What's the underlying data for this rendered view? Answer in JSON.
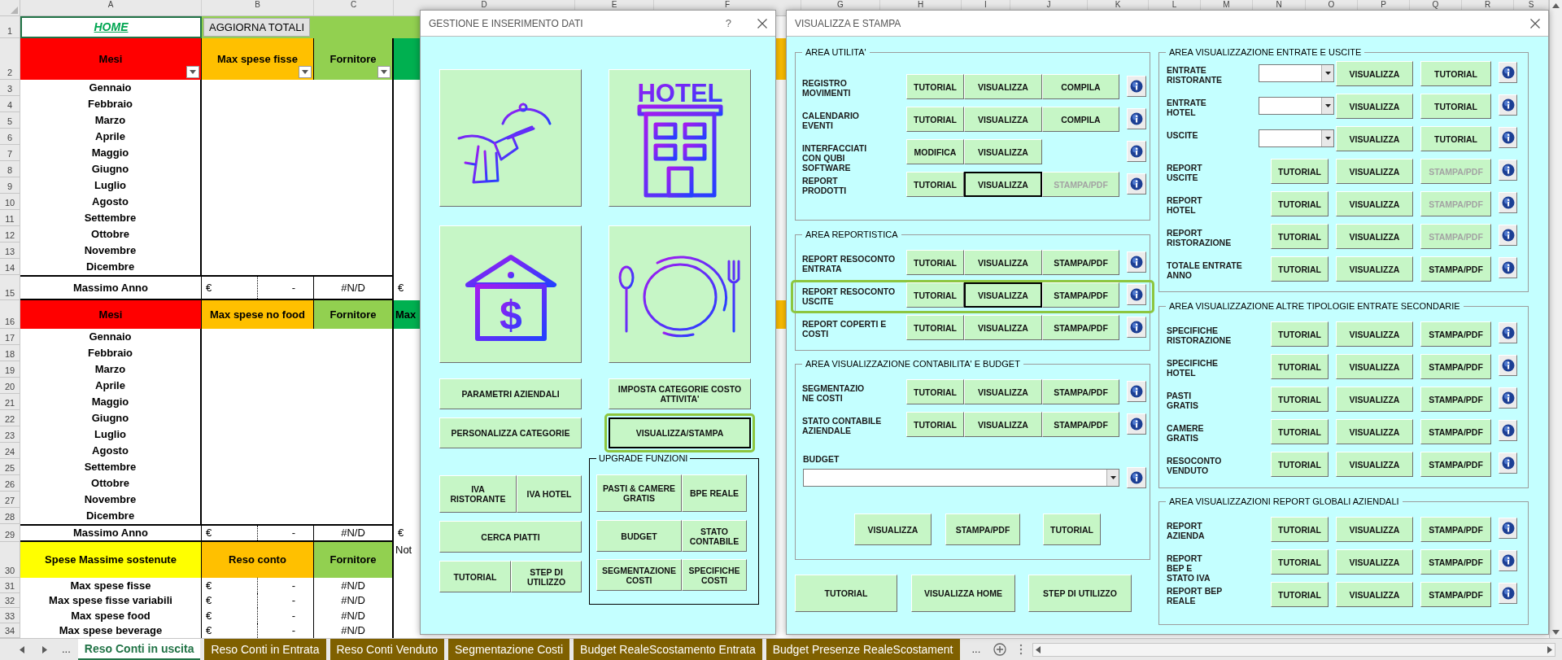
{
  "sheet": {
    "columns": [
      "A",
      "B",
      "C",
      "D",
      "E",
      "F",
      "G",
      "H",
      "I",
      "J",
      "K",
      "L",
      "M",
      "N",
      "O",
      "P",
      "Q",
      "R",
      "S"
    ],
    "rows": [
      {
        "number": "1",
        "kind": "top",
        "cells": [
          {
            "kind": "link",
            "text": "HOME"
          },
          {
            "kind": "button",
            "text": "AGGIORNA TOTALI",
            "color": "#92d050"
          },
          {
            "kind": "fill",
            "color": "#92d050"
          },
          {
            "kind": "fill",
            "color": "#92d050"
          }
        ]
      },
      {
        "number": "2",
        "kind": "header",
        "filters": true,
        "cells": [
          {
            "kind": "header",
            "text": "Mesi",
            "color": "#ff0000"
          },
          {
            "kind": "header",
            "text": "Max spese fisse",
            "color": "#ffc000"
          },
          {
            "kind": "header",
            "text": "Fornitore",
            "color": "#92d050"
          },
          {
            "kind": "fill",
            "color": "#00b050"
          },
          {
            "kind": "blank"
          },
          {
            "kind": "fill",
            "color": "#ffc000"
          }
        ]
      },
      {
        "number": "3",
        "kind": "month",
        "cells": [
          {
            "kind": "label",
            "text": "Gennaio"
          }
        ]
      },
      {
        "number": "4",
        "kind": "month",
        "cells": [
          {
            "kind": "label",
            "text": "Febbraio"
          }
        ]
      },
      {
        "number": "5",
        "kind": "month",
        "cells": [
          {
            "kind": "label",
            "text": "Marzo"
          }
        ]
      },
      {
        "number": "6",
        "kind": "month",
        "cells": [
          {
            "kind": "label",
            "text": "Aprile"
          }
        ]
      },
      {
        "number": "7",
        "kind": "month",
        "cells": [
          {
            "kind": "label",
            "text": "Maggio"
          }
        ]
      },
      {
        "number": "8",
        "kind": "month",
        "cells": [
          {
            "kind": "label",
            "text": "Giugno"
          }
        ]
      },
      {
        "number": "9",
        "kind": "month",
        "cells": [
          {
            "kind": "label",
            "text": "Luglio"
          }
        ]
      },
      {
        "number": "10",
        "kind": "month",
        "cells": [
          {
            "kind": "label",
            "text": "Agosto"
          }
        ]
      },
      {
        "number": "11",
        "kind": "month",
        "cells": [
          {
            "kind": "label",
            "text": "Settembre"
          }
        ]
      },
      {
        "number": "12",
        "kind": "month",
        "cells": [
          {
            "kind": "label",
            "text": "Ottobre"
          }
        ]
      },
      {
        "number": "13",
        "kind": "month",
        "cells": [
          {
            "kind": "label",
            "text": "Novembre"
          }
        ]
      },
      {
        "number": "14",
        "kind": "month",
        "cells": [
          {
            "kind": "label",
            "text": "Dicembre"
          }
        ]
      },
      {
        "number": "15",
        "kind": "total",
        "cells": [
          {
            "kind": "label",
            "text": "Massimo Anno"
          },
          {
            "kind": "currency",
            "symbol": "€",
            "value": "-"
          },
          {
            "kind": "value",
            "text": "#N/D"
          },
          {
            "kind": "currency",
            "symbol": "€"
          }
        ]
      },
      {
        "number": "16",
        "kind": "header",
        "filters": false,
        "cells": [
          {
            "kind": "header",
            "text": "Mesi",
            "color": "#ff0000"
          },
          {
            "kind": "header",
            "text": "Max spese no food",
            "color": "#ffc000"
          },
          {
            "kind": "header",
            "text": "Fornitore",
            "color": "#92d050"
          },
          {
            "kind": "partial",
            "text": "Max",
            "color": "#00b050"
          },
          {
            "kind": "blank"
          },
          {
            "kind": "fill",
            "color": "#ffc000"
          }
        ]
      },
      {
        "number": "17",
        "kind": "month",
        "cells": [
          {
            "kind": "label",
            "text": "Gennaio"
          }
        ]
      },
      {
        "number": "18",
        "kind": "month",
        "cells": [
          {
            "kind": "label",
            "text": "Febbraio"
          }
        ]
      },
      {
        "number": "19",
        "kind": "month",
        "cells": [
          {
            "kind": "label",
            "text": "Marzo"
          }
        ]
      },
      {
        "number": "20",
        "kind": "month",
        "cells": [
          {
            "kind": "label",
            "text": "Aprile"
          }
        ]
      },
      {
        "number": "21",
        "kind": "month",
        "cells": [
          {
            "kind": "label",
            "text": "Maggio"
          }
        ]
      },
      {
        "number": "22",
        "kind": "month",
        "cells": [
          {
            "kind": "label",
            "text": "Giugno"
          }
        ]
      },
      {
        "number": "23",
        "kind": "month",
        "cells": [
          {
            "kind": "label",
            "text": "Luglio"
          }
        ]
      },
      {
        "number": "24",
        "kind": "month",
        "cells": [
          {
            "kind": "label",
            "text": "Agosto"
          }
        ]
      },
      {
        "number": "25",
        "kind": "month",
        "cells": [
          {
            "kind": "label",
            "text": "Settembre"
          }
        ]
      },
      {
        "number": "26",
        "kind": "month",
        "cells": [
          {
            "kind": "label",
            "text": "Ottobre"
          }
        ]
      },
      {
        "number": "27",
        "kind": "month",
        "cells": [
          {
            "kind": "label",
            "text": "Novembre"
          }
        ]
      },
      {
        "number": "28",
        "kind": "month",
        "cells": [
          {
            "kind": "label",
            "text": "Dicembre"
          }
        ]
      },
      {
        "number": "29",
        "kind": "total",
        "cells": [
          {
            "kind": "label",
            "text": "Massimo Anno"
          },
          {
            "kind": "currency",
            "symbol": "€",
            "value": "-"
          },
          {
            "kind": "value",
            "text": "#N/D"
          },
          {
            "kind": "currency",
            "symbol": "€"
          }
        ]
      },
      {
        "number": "30",
        "kind": "header",
        "filters": false,
        "cells": [
          {
            "kind": "header",
            "text": "Spese Massime sostenute",
            "color": "#ffff00"
          },
          {
            "kind": "header",
            "text": "Reso conto",
            "color": "#ffc000"
          },
          {
            "kind": "header",
            "text": "Fornitore",
            "color": "#92d050"
          },
          {
            "kind": "note",
            "text": "Not"
          }
        ]
      },
      {
        "number": "31",
        "kind": "detail",
        "cells": [
          {
            "kind": "label",
            "text": "Max spese fisse"
          },
          {
            "kind": "currency",
            "symbol": "€",
            "value": "-"
          },
          {
            "kind": "value",
            "text": "#N/D"
          }
        ]
      },
      {
        "number": "32",
        "kind": "detail",
        "cells": [
          {
            "kind": "label",
            "text": "Max spese fisse variabili"
          },
          {
            "kind": "currency",
            "symbol": "€",
            "value": "-"
          },
          {
            "kind": "value",
            "text": "#N/D"
          }
        ]
      },
      {
        "number": "33",
        "kind": "detail",
        "cells": [
          {
            "kind": "label",
            "text": "Max spese food"
          },
          {
            "kind": "currency",
            "symbol": "€",
            "value": "-"
          },
          {
            "kind": "value",
            "text": "#N/D"
          }
        ]
      },
      {
        "number": "34",
        "kind": "detail",
        "cells": [
          {
            "kind": "label",
            "text": "Max spese beverage"
          },
          {
            "kind": "currency",
            "symbol": "€",
            "value": "-"
          },
          {
            "kind": "value",
            "text": "#N/D"
          }
        ]
      }
    ]
  },
  "sheet_tabs": {
    "more_left": "...",
    "more_right": "...",
    "tabs": [
      {
        "label": "Reso Conti in uscita",
        "selected": true
      },
      {
        "label": "Reso Conti in Entrata",
        "selected": false
      },
      {
        "label": "Reso Conti Venduto",
        "selected": false
      },
      {
        "label": "Segmentazione Costi",
        "selected": false
      },
      {
        "label": "Budget RealeScostamento Entrata",
        "selected": false
      },
      {
        "label": "Budget Presenze RealeScostament",
        "selected": false
      }
    ]
  },
  "manage_dialog": {
    "title": "GESTIONE E INSERIMENTO DATI",
    "help": "?",
    "tiles": [
      {
        "kind": "waiter"
      },
      {
        "kind": "hotel",
        "sign": "HOTEL"
      },
      {
        "kind": "house",
        "symbol": "$"
      },
      {
        "kind": "plate"
      }
    ],
    "buttons": [
      {
        "label": "PARAMETRI AZIENDALI",
        "highlighted": false,
        "focused": false
      },
      {
        "label": "IMPOSTA CATEGORIE COSTO\nATTIVITA'",
        "highlighted": false,
        "focused": false
      },
      {
        "label": "PERSONALIZZA CATEGORIE",
        "highlighted": false,
        "focused": false
      },
      {
        "label": "VISUALIZZA/STAMPA",
        "highlighted": true,
        "focused": true
      }
    ],
    "small_buttons": [
      [
        "IVA\nRISTORANTE",
        "IVA HOTEL"
      ],
      [
        "CERCA PIATTI"
      ],
      [
        "TUTORIAL",
        "STEP DI\nUTILIZZO"
      ]
    ],
    "upgrade": {
      "title": "UPGRADE FUNZIONI",
      "buttons": [
        [
          "PASTI & CAMERE\nGRATIS",
          "BPE REALE"
        ],
        [
          "BUDGET",
          "STATO\nCONTABILE"
        ],
        [
          "SEGMENTAZIONE\nCOSTI",
          "SPECIFICHE\nCOSTI"
        ]
      ]
    }
  },
  "print_dialog": {
    "title": "VISUALIZZA E STAMPA",
    "left": [
      {
        "title": "AREA UTILITA'",
        "rows": [
          {
            "label": "REGISTRO\nMOVIMENTI",
            "highlighted": false,
            "controls": [
              {
                "kind": "button",
                "label": "TUTORIAL",
                "disabled": false,
                "focused": false
              },
              {
                "kind": "button",
                "label": "VISUALIZZA",
                "disabled": false,
                "focused": false
              },
              {
                "kind": "button",
                "label": "COMPILA",
                "disabled": false,
                "focused": false
              }
            ]
          },
          {
            "label": "CALENDARIO\nEVENTI",
            "highlighted": false,
            "controls": [
              {
                "kind": "button",
                "label": "TUTORIAL",
                "disabled": false,
                "focused": false
              },
              {
                "kind": "button",
                "label": "VISUALIZZA",
                "disabled": false,
                "focused": false
              },
              {
                "kind": "button",
                "label": "COMPILA",
                "disabled": false,
                "focused": false
              }
            ]
          },
          {
            "label": "INTERFACCIATI\nCON QUBI\nSOFTWARE",
            "highlighted": false,
            "controls": [
              {
                "kind": "button",
                "label": "MODIFICA",
                "disabled": false,
                "focused": false
              },
              {
                "kind": "button",
                "label": "VISUALIZZA",
                "disabled": false,
                "focused": false
              }
            ]
          },
          {
            "label": "REPORT\nPRODOTTI",
            "highlighted": false,
            "controls": [
              {
                "kind": "button",
                "label": "TUTORIAL",
                "disabled": false,
                "focused": false
              },
              {
                "kind": "button",
                "label": "VISUALIZZA",
                "disabled": false,
                "focused": true
              },
              {
                "kind": "button",
                "label": "STAMPA/PDF",
                "disabled": true,
                "focused": false
              }
            ]
          }
        ]
      },
      {
        "title": "AREA REPORTISTICA",
        "rows": [
          {
            "label": "REPORT RESOCONTO\nENTRATA",
            "highlighted": false,
            "controls": [
              {
                "kind": "button",
                "label": "TUTORIAL",
                "disabled": false,
                "focused": false
              },
              {
                "kind": "button",
                "label": "VISUALIZZA",
                "disabled": false,
                "focused": false
              },
              {
                "kind": "button",
                "label": "STAMPA/PDF",
                "disabled": false,
                "focused": false
              }
            ]
          },
          {
            "label": "REPORT RESOCONTO\nUSCITE",
            "highlighted": true,
            "controls": [
              {
                "kind": "button",
                "label": "TUTORIAL",
                "disabled": false,
                "focused": false
              },
              {
                "kind": "button",
                "label": "VISUALIZZA",
                "disabled": false,
                "focused": true
              },
              {
                "kind": "button",
                "label": "STAMPA/PDF",
                "disabled": false,
                "focused": false
              }
            ]
          },
          {
            "label": "REPORT COPERTI E\nCOSTI",
            "highlighted": false,
            "controls": [
              {
                "kind": "button",
                "label": "TUTORIAL",
                "disabled": false,
                "focused": false
              },
              {
                "kind": "button",
                "label": "VISUALIZZA",
                "disabled": false,
                "focused": false
              },
              {
                "kind": "button",
                "label": "STAMPA/PDF",
                "disabled": false,
                "focused": false
              }
            ]
          }
        ]
      },
      {
        "title": "AREA VISUALIZZAZIONE CONTABILITA' E BUDGET",
        "rows": [
          {
            "label": "SEGMENTAZIO\nNE COSTI",
            "highlighted": false,
            "controls": [
              {
                "kind": "button",
                "label": "TUTORIAL",
                "disabled": false,
                "focused": false
              },
              {
                "kind": "button",
                "label": "VISUALIZZA",
                "disabled": false,
                "focused": false
              },
              {
                "kind": "button",
                "label": "STAMPA/PDF",
                "disabled": false,
                "focused": false
              }
            ]
          },
          {
            "label": "STATO CONTABILE\nAZIENDALE",
            "highlighted": false,
            "controls": [
              {
                "kind": "button",
                "label": "TUTORIAL",
                "disabled": false,
                "focused": false
              },
              {
                "kind": "button",
                "label": "VISUALIZZA",
                "disabled": false,
                "focused": false
              },
              {
                "kind": "button",
                "label": "STAMPA/PDF",
                "disabled": false,
                "focused": false
              }
            ]
          }
        ],
        "budget": {
          "label": "BUDGET",
          "actions": [
            "VISUALIZZA",
            "STAMPA/PDF",
            "TUTORIAL"
          ]
        }
      }
    ],
    "footer": [
      "TUTORIAL",
      "VISUALIZZA HOME",
      "STEP DI UTILIZZO"
    ],
    "right": [
      {
        "title": "AREA VISUALIZZAZIONE ENTRATE E USCITE",
        "rows": [
          {
            "label": "ENTRATE\nRISTORANTE",
            "highlighted": false,
            "controls": [
              {
                "kind": "dropdown"
              },
              {
                "kind": "button",
                "label": "VISUALIZZA",
                "disabled": false,
                "focused": false
              },
              {
                "kind": "button",
                "label": "TUTORIAL",
                "disabled": false,
                "focused": false
              }
            ]
          },
          {
            "label": "ENTRATE\nHOTEL",
            "highlighted": false,
            "controls": [
              {
                "kind": "dropdown"
              },
              {
                "kind": "button",
                "label": "VISUALIZZA",
                "disabled": false,
                "focused": false
              },
              {
                "kind": "button",
                "label": "TUTORIAL",
                "disabled": false,
                "focused": false
              }
            ]
          },
          {
            "label": "USCITE",
            "highlighted": false,
            "controls": [
              {
                "kind": "dropdown"
              },
              {
                "kind": "button",
                "label": "VISUALIZZA",
                "disabled": false,
                "focused": false
              },
              {
                "kind": "button",
                "label": "TUTORIAL",
                "disabled": false,
                "focused": false
              }
            ]
          },
          {
            "label": "REPORT\nUSCITE",
            "highlighted": false,
            "controls": [
              {
                "kind": "button",
                "label": "TUTORIAL",
                "disabled": false,
                "focused": false
              },
              {
                "kind": "button",
                "label": "VISUALIZZA",
                "disabled": false,
                "focused": false
              },
              {
                "kind": "button",
                "label": "STAMPA/PDF",
                "disabled": true,
                "focused": false
              }
            ]
          },
          {
            "label": "REPORT\nHOTEL",
            "highlighted": false,
            "controls": [
              {
                "kind": "button",
                "label": "TUTORIAL",
                "disabled": false,
                "focused": false
              },
              {
                "kind": "button",
                "label": "VISUALIZZA",
                "disabled": false,
                "focused": false
              },
              {
                "kind": "button",
                "label": "STAMPA/PDF",
                "disabled": true,
                "focused": false
              }
            ]
          },
          {
            "label": "REPORT\nRISTORAZIONE",
            "highlighted": false,
            "controls": [
              {
                "kind": "button",
                "label": "TUTORIAL",
                "disabled": false,
                "focused": false
              },
              {
                "kind": "button",
                "label": "VISUALIZZA",
                "disabled": false,
                "focused": false
              },
              {
                "kind": "button",
                "label": "STAMPA/PDF",
                "disabled": true,
                "focused": false
              }
            ]
          },
          {
            "label": "TOTALE ENTRATE\nANNO",
            "highlighted": false,
            "controls": [
              {
                "kind": "button",
                "label": "TUTORIAL",
                "disabled": false,
                "focused": false
              },
              {
                "kind": "button",
                "label": "VISUALIZZA",
                "disabled": false,
                "focused": false
              },
              {
                "kind": "button",
                "label": "STAMPA/PDF",
                "disabled": false,
                "focused": false
              }
            ]
          }
        ]
      },
      {
        "title": "AREA VISUALIZZAZIONE ALTRE TIPOLOGIE ENTRATE SECONDARIE",
        "rows": [
          {
            "label": "SPECIFICHE\nRISTORAZIONE",
            "highlighted": false,
            "controls": [
              {
                "kind": "button",
                "label": "TUTORIAL",
                "disabled": false,
                "focused": false
              },
              {
                "kind": "button",
                "label": "VISUALIZZA",
                "disabled": false,
                "focused": false
              },
              {
                "kind": "button",
                "label": "STAMPA/PDF",
                "disabled": false,
                "focused": false
              }
            ]
          },
          {
            "label": "SPECIFICHE\nHOTEL",
            "highlighted": false,
            "controls": [
              {
                "kind": "button",
                "label": "TUTORIAL",
                "disabled": false,
                "focused": false
              },
              {
                "kind": "button",
                "label": "VISUALIZZA",
                "disabled": false,
                "focused": false
              },
              {
                "kind": "button",
                "label": "STAMPA/PDF",
                "disabled": false,
                "focused": false
              }
            ]
          },
          {
            "label": "PASTI\nGRATIS",
            "highlighted": false,
            "controls": [
              {
                "kind": "button",
                "label": "TUTORIAL",
                "disabled": false,
                "focused": false
              },
              {
                "kind": "button",
                "label": "VISUALIZZA",
                "disabled": false,
                "focused": false
              },
              {
                "kind": "button",
                "label": "STAMPA/PDF",
                "disabled": false,
                "focused": false
              }
            ]
          },
          {
            "label": "CAMERE\nGRATIS",
            "highlighted": false,
            "controls": [
              {
                "kind": "button",
                "label": "TUTORIAL",
                "disabled": false,
                "focused": false
              },
              {
                "kind": "button",
                "label": "VISUALIZZA",
                "disabled": false,
                "focused": false
              },
              {
                "kind": "button",
                "label": "STAMPA/PDF",
                "disabled": false,
                "focused": false
              }
            ]
          },
          {
            "label": "RESOCONTO\nVENDUTO",
            "highlighted": false,
            "controls": [
              {
                "kind": "button",
                "label": "TUTORIAL",
                "disabled": false,
                "focused": false
              },
              {
                "kind": "button",
                "label": "VISUALIZZA",
                "disabled": false,
                "focused": false
              },
              {
                "kind": "button",
                "label": "STAMPA/PDF",
                "disabled": false,
                "focused": false
              }
            ]
          }
        ]
      },
      {
        "title": "AREA VISUALIZZAZIONI REPORT GLOBALI AZIENDALI",
        "rows": [
          {
            "label": "REPORT\nAZIENDA",
            "highlighted": false,
            "controls": [
              {
                "kind": "button",
                "label": "TUTORIAL",
                "disabled": false,
                "focused": false
              },
              {
                "kind": "button",
                "label": "VISUALIZZA",
                "disabled": false,
                "focused": false
              },
              {
                "kind": "button",
                "label": "STAMPA/PDF",
                "disabled": false,
                "focused": false
              }
            ]
          },
          {
            "label": "REPORT\nBEP E\nSTATO IVA",
            "highlighted": false,
            "controls": [
              {
                "kind": "button",
                "label": "TUTORIAL",
                "disabled": false,
                "focused": false
              },
              {
                "kind": "button",
                "label": "VISUALIZZA",
                "disabled": false,
                "focused": false
              },
              {
                "kind": "button",
                "label": "STAMPA/PDF",
                "disabled": false,
                "focused": false
              }
            ]
          },
          {
            "label": "REPORT BEP\nREALE",
            "highlighted": false,
            "controls": [
              {
                "kind": "button",
                "label": "TUTORIAL",
                "disabled": false,
                "focused": false
              },
              {
                "kind": "button",
                "label": "VISUALIZZA",
                "disabled": false,
                "focused": false
              },
              {
                "kind": "button",
                "label": "STAMPA/PDF",
                "disabled": false,
                "focused": false
              }
            ]
          }
        ]
      }
    ]
  }
}
